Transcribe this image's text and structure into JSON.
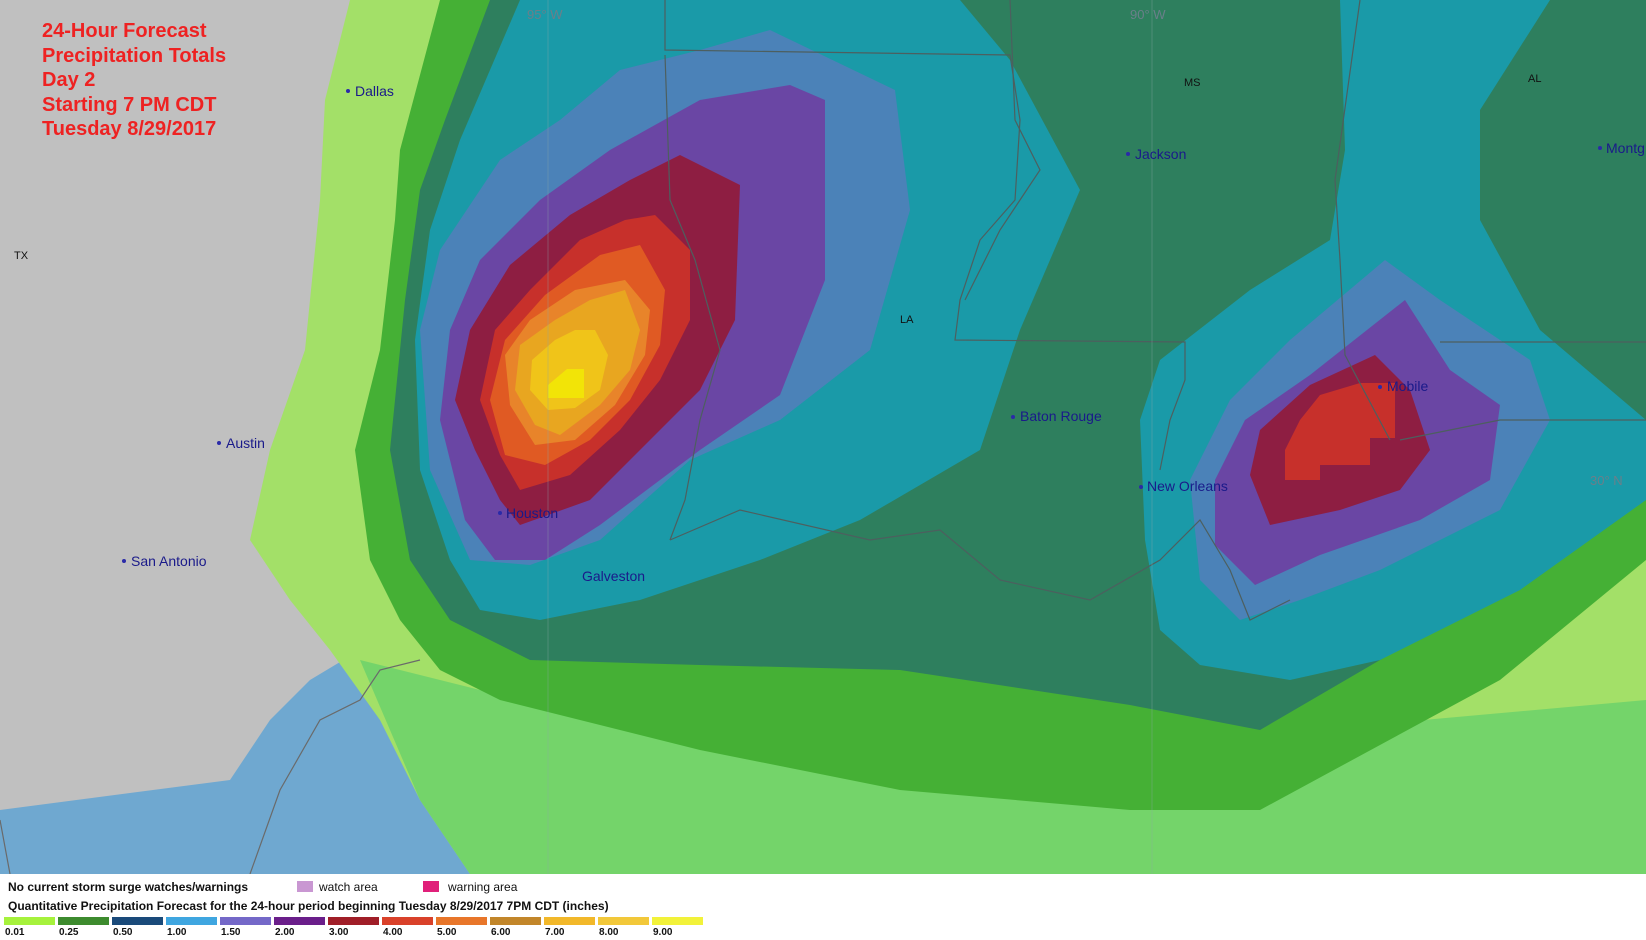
{
  "title": {
    "line1": "24-Hour Forecast",
    "line2": "Precipitation Totals",
    "line3": "Day 2",
    "line4": "Starting 7 PM CDT",
    "line5": "Tuesday 8/29/2017"
  },
  "graticule": {
    "lon1": "95° W",
    "lon2": "90° W",
    "lat1": "30° N"
  },
  "states": {
    "tx": "TX",
    "la": "LA",
    "ms": "MS",
    "al": "AL"
  },
  "cities": {
    "dallas": "Dallas",
    "austin": "Austin",
    "san_antonio": "San Antonio",
    "houston": "Houston",
    "galveston": "Galveston",
    "baton_rouge": "Baton Rouge",
    "new_orleans": "New Orleans",
    "jackson": "Jackson",
    "mobile": "Mobile",
    "montgomery": "Montg"
  },
  "legend": {
    "surge_status": "No current storm surge watches/warnings",
    "watch_label": "watch area",
    "warning_label": "warning area",
    "qpf_title": "Quantitative Precipitation Forecast for the 24-hour period beginning Tuesday 8/29/2017 7PM CDT (inches)",
    "scale": [
      {
        "value": "0.01",
        "color": "#a6f23c"
      },
      {
        "value": "0.25",
        "color": "#3d8b2e"
      },
      {
        "value": "0.50",
        "color": "#1a4a7a"
      },
      {
        "value": "1.00",
        "color": "#3fa6e0"
      },
      {
        "value": "1.50",
        "color": "#7468c8"
      },
      {
        "value": "2.00",
        "color": "#6a1e8a"
      },
      {
        "value": "3.00",
        "color": "#a01e28"
      },
      {
        "value": "4.00",
        "color": "#d9412a"
      },
      {
        "value": "5.00",
        "color": "#e8762a"
      },
      {
        "value": "6.00",
        "color": "#c2862a"
      },
      {
        "value": "7.00",
        "color": "#f2b82a"
      },
      {
        "value": "8.00",
        "color": "#f2c83a"
      },
      {
        "value": "9.00",
        "color": "#f2f23a"
      }
    ]
  },
  "colors": {
    "title": "#ee2222",
    "land": "#c0c0c0",
    "water": "#6fa8d0",
    "watch": "#c997d2",
    "warning": "#e0207a"
  }
}
